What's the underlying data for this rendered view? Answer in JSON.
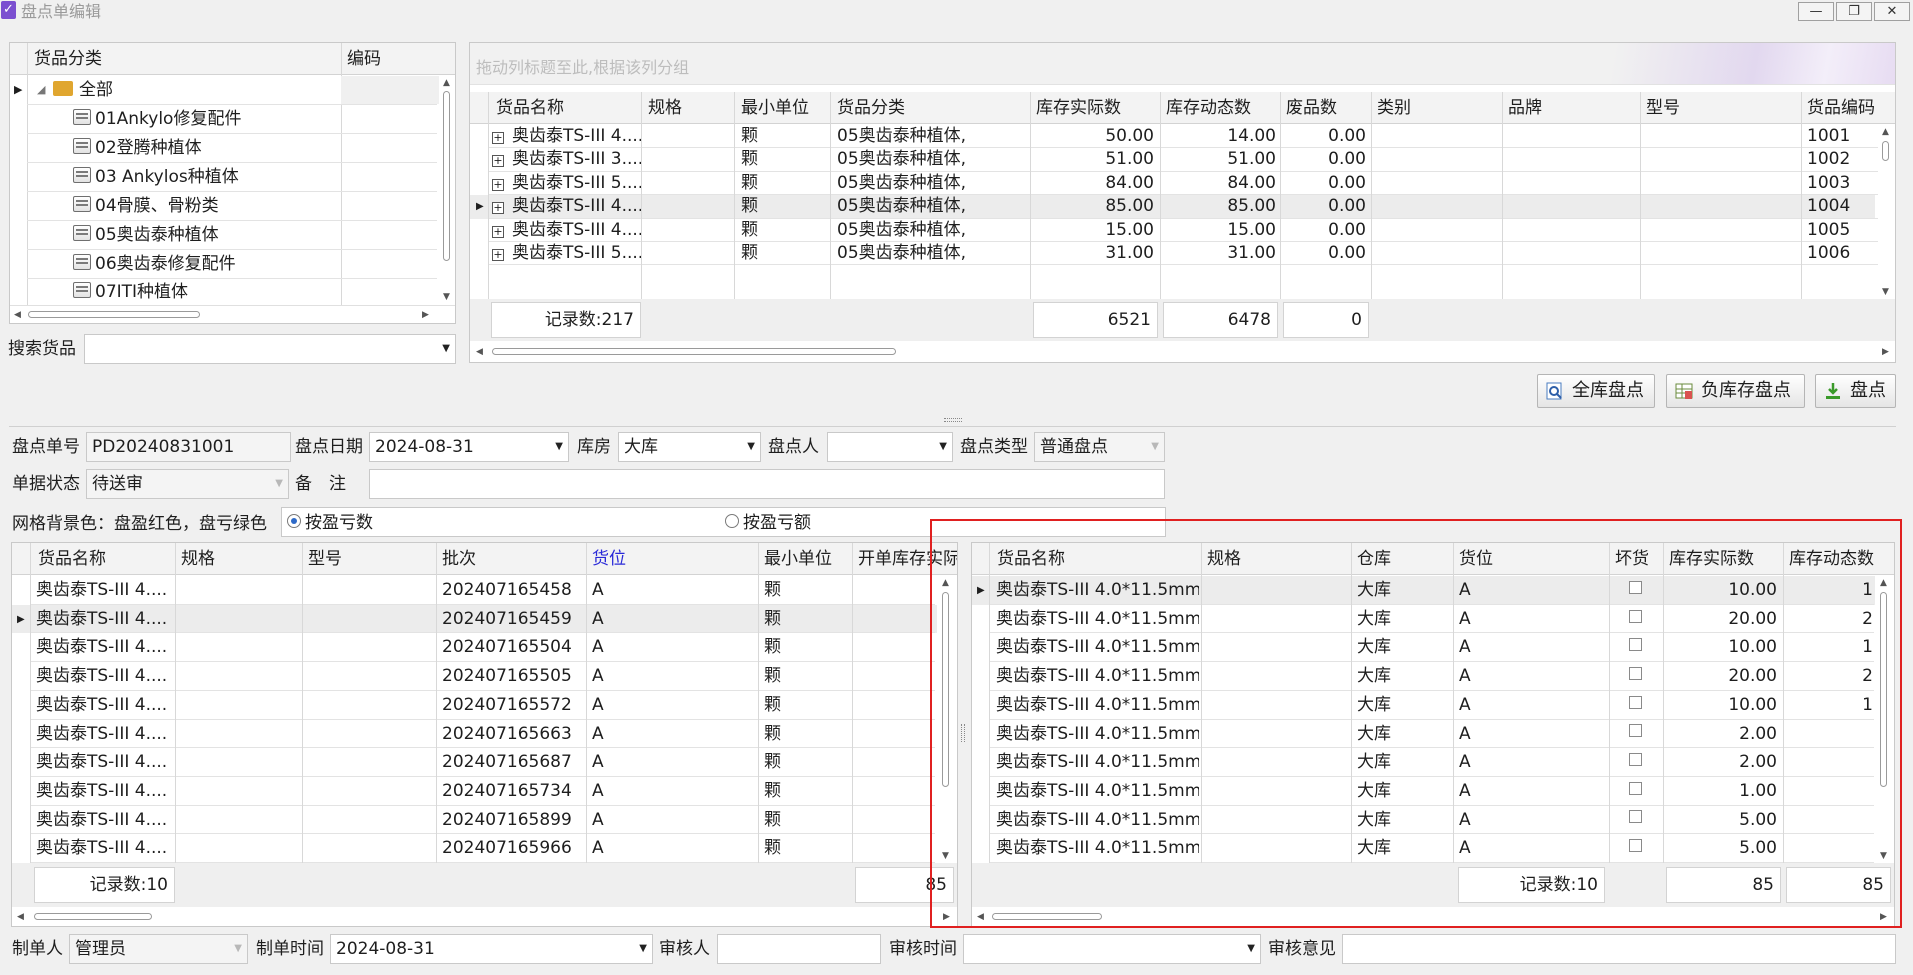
{
  "window": {
    "title": "盘点单编辑",
    "minimize_icon": "minimize-icon",
    "restore_icon": "restore-icon",
    "close_icon": "close-icon"
  },
  "category_tree": {
    "col_category": "货品分类",
    "col_code": "编码",
    "root": "全部",
    "items": [
      "01Ankylo修复配件",
      "02登腾种植体",
      "03 Ankylos种植体",
      "04骨膜、骨粉类",
      "05奥齿泰种植体",
      "06奥齿泰修复配件",
      "07ITI种植体"
    ]
  },
  "search": {
    "label": "搜索货品",
    "value": ""
  },
  "goods_grid": {
    "group_hint": "拖动列标题至此,根据该列分组",
    "columns": [
      "货品名称",
      "规格",
      "最小单位",
      "货品分类",
      "库存实际数",
      "库存动态数",
      "废品数",
      "类别",
      "品牌",
      "型号",
      "货品编码"
    ],
    "rows": [
      {
        "name": "奥齿泰TS-III 4....",
        "spec": "",
        "unit": "颗",
        "category": "05奥齿泰种植体,",
        "actual": "50.00",
        "dynamic": "14.00",
        "waste": "0.00",
        "type": "",
        "brand": "",
        "model": "",
        "code": "1001"
      },
      {
        "name": "奥齿泰TS-III 3....",
        "spec": "",
        "unit": "颗",
        "category": "05奥齿泰种植体,",
        "actual": "51.00",
        "dynamic": "51.00",
        "waste": "0.00",
        "type": "",
        "brand": "",
        "model": "",
        "code": "1002"
      },
      {
        "name": "奥齿泰TS-III 5....",
        "spec": "",
        "unit": "颗",
        "category": "05奥齿泰种植体,",
        "actual": "84.00",
        "dynamic": "84.00",
        "waste": "0.00",
        "type": "",
        "brand": "",
        "model": "",
        "code": "1003"
      },
      {
        "name": "奥齿泰TS-III 4....",
        "spec": "",
        "unit": "颗",
        "category": "05奥齿泰种植体,",
        "actual": "85.00",
        "dynamic": "85.00",
        "waste": "0.00",
        "type": "",
        "brand": "",
        "model": "",
        "code": "1004"
      },
      {
        "name": "奥齿泰TS-III 4....",
        "spec": "",
        "unit": "颗",
        "category": "05奥齿泰种植体,",
        "actual": "15.00",
        "dynamic": "15.00",
        "waste": "0.00",
        "type": "",
        "brand": "",
        "model": "",
        "code": "1005"
      },
      {
        "name": "奥齿泰TS-III 5....",
        "spec": "",
        "unit": "颗",
        "category": "05奥齿泰种植体,",
        "actual": "31.00",
        "dynamic": "31.00",
        "waste": "0.00",
        "type": "",
        "brand": "",
        "model": "",
        "code": "1006"
      }
    ],
    "record_count": "记录数:217",
    "sum_actual": "6521",
    "sum_dynamic": "6478",
    "sum_waste": "0"
  },
  "actions": {
    "full_count": "全库盘点",
    "negative_count": "负库存盘点",
    "count": "盘点"
  },
  "form": {
    "no_label": "盘点单号",
    "no_value": "PD20240831001",
    "date_label": "盘点日期",
    "date_value": "2024-08-31",
    "warehouse_label": "库房",
    "warehouse_value": "大库",
    "person_label": "盘点人",
    "person_value": "",
    "type_label": "盘点类型",
    "type_value": "普通盘点",
    "status_label": "单据状态",
    "status_value": "待送审",
    "remark_label": "备　注",
    "remark_value": "",
    "bg_note": "网格背景色：盘盈红色，盘亏绿色",
    "radio_qty": "按盈亏数",
    "radio_amount": "按盈亏额"
  },
  "batch_grid": {
    "columns": [
      "货品名称",
      "规格",
      "型号",
      "批次",
      "货位",
      "最小单位",
      "开单库存实际"
    ],
    "rows": [
      {
        "name": "奥齿泰TS-III 4....",
        "batch": "202407165458",
        "loc": "A",
        "unit": "颗"
      },
      {
        "name": "奥齿泰TS-III 4....",
        "batch": "202407165459",
        "loc": "A",
        "unit": "颗"
      },
      {
        "name": "奥齿泰TS-III 4....",
        "batch": "202407165504",
        "loc": "A",
        "unit": "颗"
      },
      {
        "name": "奥齿泰TS-III 4....",
        "batch": "202407165505",
        "loc": "A",
        "unit": "颗"
      },
      {
        "name": "奥齿泰TS-III 4....",
        "batch": "202407165572",
        "loc": "A",
        "unit": "颗"
      },
      {
        "name": "奥齿泰TS-III 4....",
        "batch": "202407165663",
        "loc": "A",
        "unit": "颗"
      },
      {
        "name": "奥齿泰TS-III 4....",
        "batch": "202407165687",
        "loc": "A",
        "unit": "颗"
      },
      {
        "name": "奥齿泰TS-III 4....",
        "batch": "202407165734",
        "loc": "A",
        "unit": "颗"
      },
      {
        "name": "奥齿泰TS-III 4....",
        "batch": "202407165899",
        "loc": "A",
        "unit": "颗"
      },
      {
        "name": "奥齿泰TS-III 4....",
        "batch": "202407165966",
        "loc": "A",
        "unit": "颗"
      }
    ],
    "record_count": "记录数:10",
    "sum": "85"
  },
  "detail_grid": {
    "columns": [
      "货品名称",
      "规格",
      "仓库",
      "货位",
      "坏货",
      "库存实际数",
      "库存动态数"
    ],
    "rows": [
      {
        "name": "奥齿泰TS-III 4.0*11.5mm",
        "wh": "大库",
        "loc": "A",
        "actual": "10.00",
        "dyn": "1"
      },
      {
        "name": "奥齿泰TS-III 4.0*11.5mm",
        "wh": "大库",
        "loc": "A",
        "actual": "20.00",
        "dyn": "2"
      },
      {
        "name": "奥齿泰TS-III 4.0*11.5mm",
        "wh": "大库",
        "loc": "A",
        "actual": "10.00",
        "dyn": "1"
      },
      {
        "name": "奥齿泰TS-III 4.0*11.5mm",
        "wh": "大库",
        "loc": "A",
        "actual": "20.00",
        "dyn": "2"
      },
      {
        "name": "奥齿泰TS-III 4.0*11.5mm",
        "wh": "大库",
        "loc": "A",
        "actual": "10.00",
        "dyn": "1"
      },
      {
        "name": "奥齿泰TS-III 4.0*11.5mm",
        "wh": "大库",
        "loc": "A",
        "actual": "2.00",
        "dyn": ""
      },
      {
        "name": "奥齿泰TS-III 4.0*11.5mm",
        "wh": "大库",
        "loc": "A",
        "actual": "2.00",
        "dyn": ""
      },
      {
        "name": "奥齿泰TS-III 4.0*11.5mm",
        "wh": "大库",
        "loc": "A",
        "actual": "1.00",
        "dyn": ""
      },
      {
        "name": "奥齿泰TS-III 4.0*11.5mm",
        "wh": "大库",
        "loc": "A",
        "actual": "5.00",
        "dyn": ""
      },
      {
        "name": "奥齿泰TS-III 4.0*11.5mm",
        "wh": "大库",
        "loc": "A",
        "actual": "5.00",
        "dyn": ""
      }
    ],
    "record_count": "记录数:10",
    "sum_actual": "85",
    "sum_dynamic": "85"
  },
  "footer": {
    "maker_label": "制单人",
    "maker_value": "管理员",
    "make_time_label": "制单时间",
    "make_time_value": "2024-08-31",
    "reviewer_label": "审核人",
    "reviewer_value": "",
    "review_time_label": "审核时间",
    "review_time_value": "",
    "review_opinion_label": "审核意见",
    "review_opinion_value": ""
  },
  "colors": {
    "highlight_border": "#e02020",
    "location_header": "#2a2ad8",
    "selected_row": "#ececec"
  }
}
